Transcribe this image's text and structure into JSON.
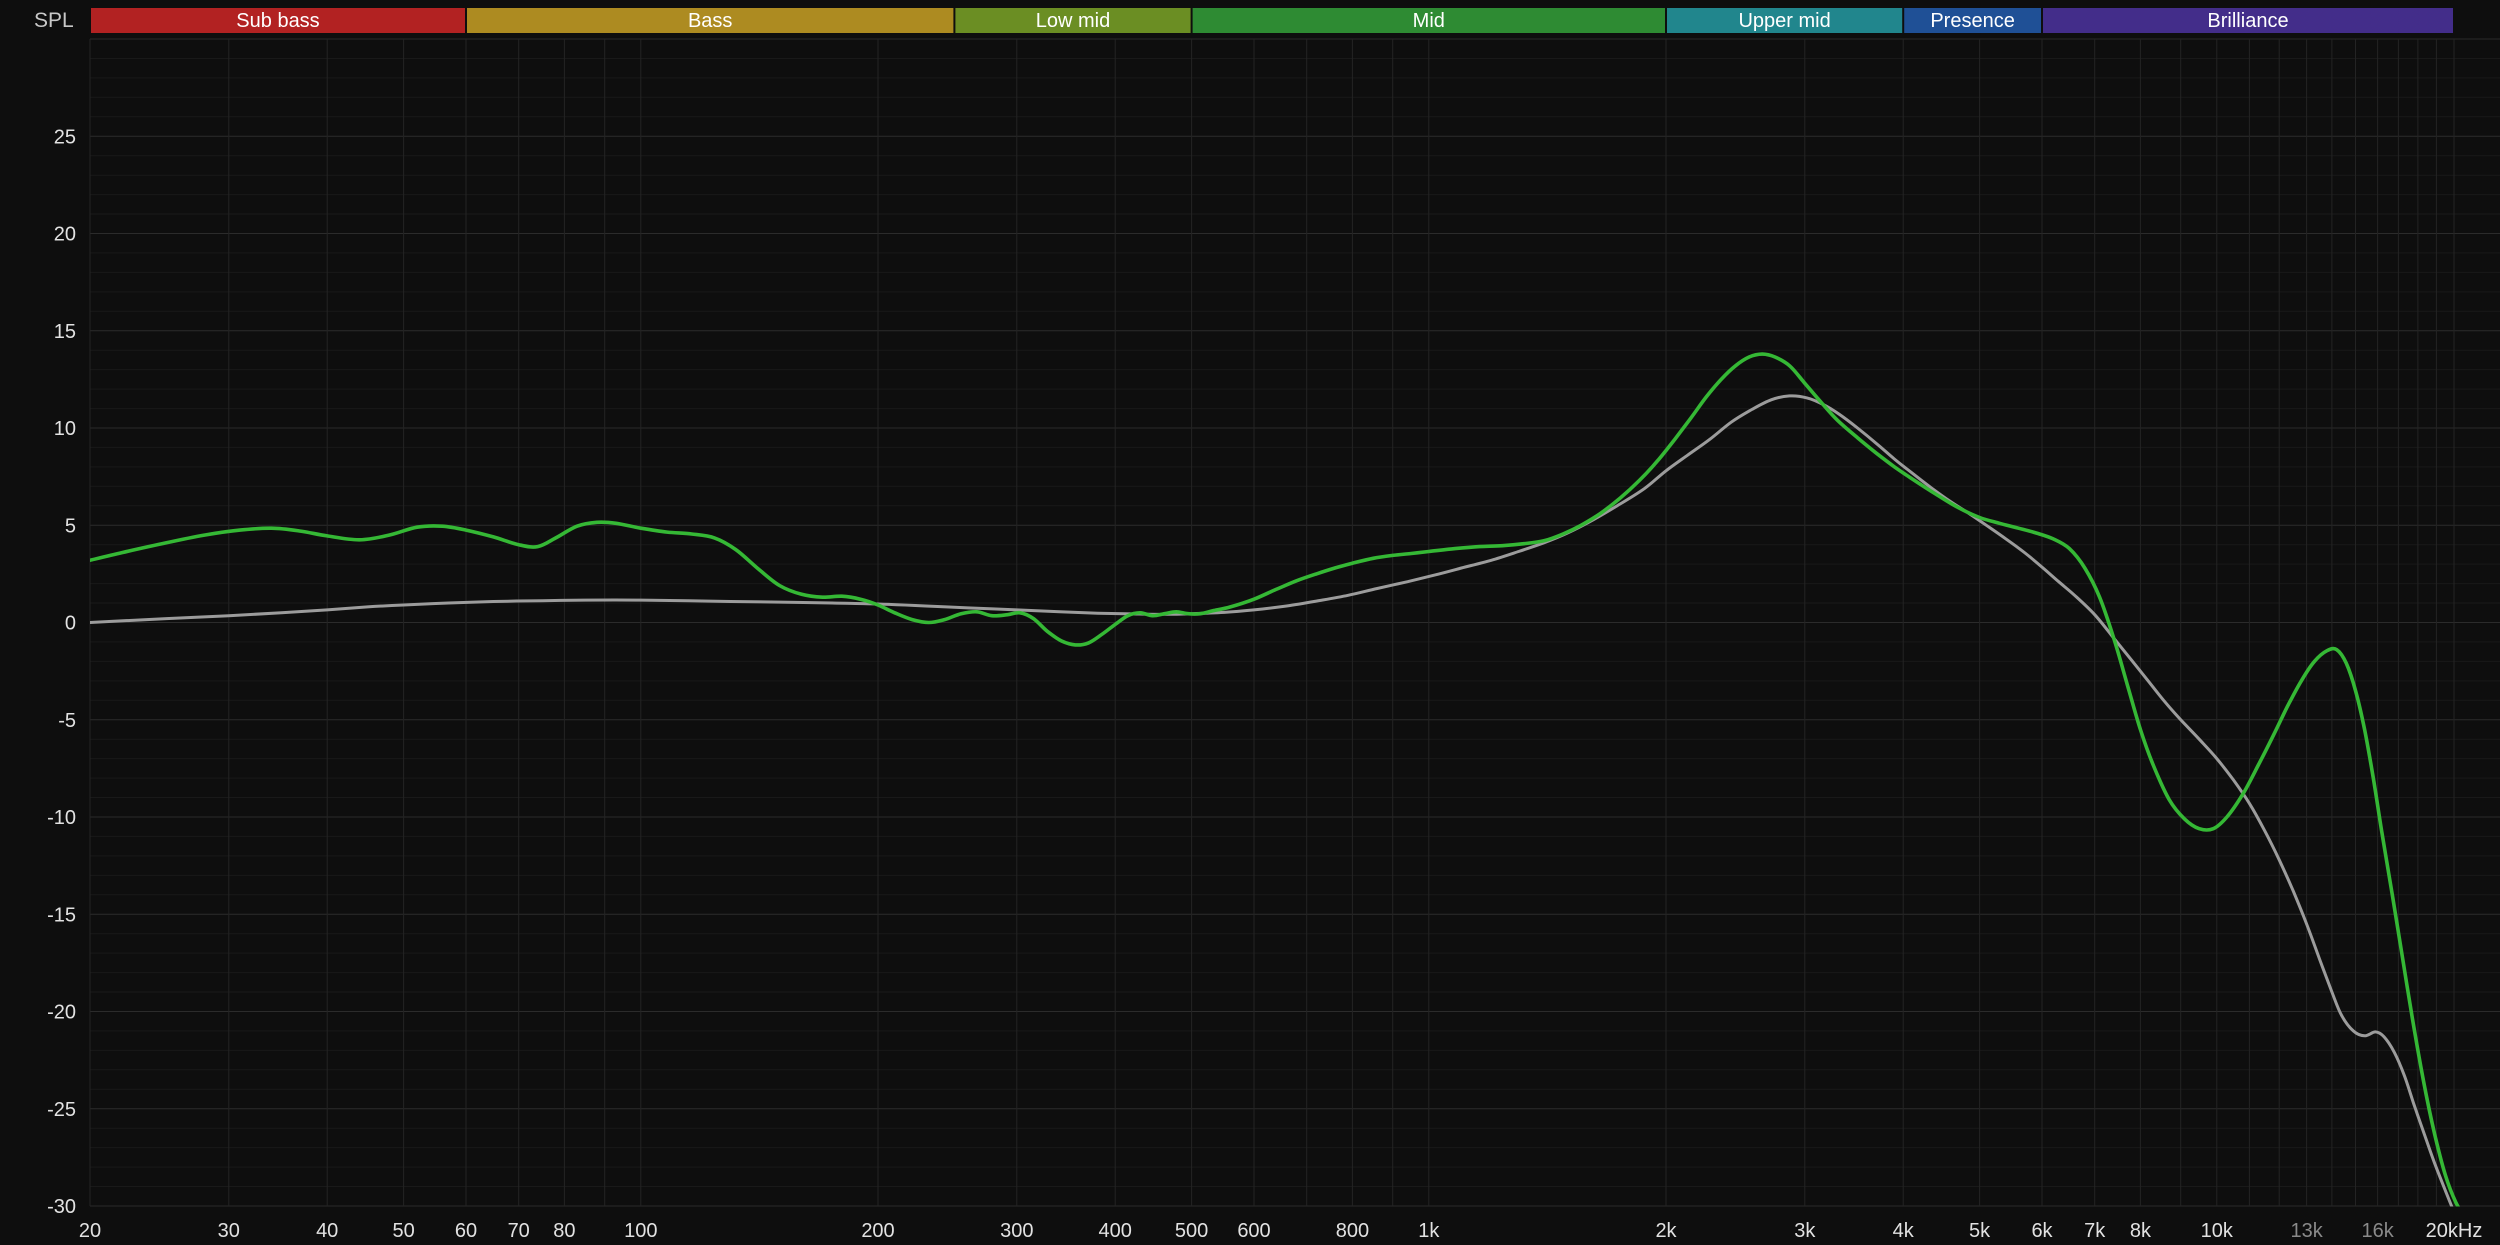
{
  "spl_label": "SPL",
  "colors": {
    "background": "#0e0e0e",
    "grid_major": "#2b2b2b",
    "grid_minor": "#191919",
    "grid_vertical": "#242424",
    "tick_label": "#e2e2e2",
    "tick_label_dim": "#8a8a8a",
    "band_text": "#ffffff",
    "spl_label": "#c8c8c8"
  },
  "band_bar": [
    {
      "label": "Sub bass",
      "color": "#b22222",
      "f_lo": 20,
      "f_hi": 60
    },
    {
      "label": "Bass",
      "color": "#ad8b21",
      "f_lo": 60,
      "f_hi": 250
    },
    {
      "label": "Low mid",
      "color": "#6b8e23",
      "f_lo": 250,
      "f_hi": 500
    },
    {
      "label": "Mid",
      "color": "#2e8b33",
      "f_lo": 500,
      "f_hi": 2000
    },
    {
      "label": "Upper mid",
      "color": "#21868d",
      "f_lo": 2000,
      "f_hi": 4000
    },
    {
      "label": "Presence",
      "color": "#1f5096",
      "f_lo": 4000,
      "f_hi": 6000
    },
    {
      "label": "Brilliance",
      "color": "#432d8a",
      "f_lo": 6000,
      "f_hi": 20000
    }
  ],
  "chart_data": {
    "type": "line",
    "title": "",
    "ylabel": "SPL",
    "x_scale": "log",
    "xlim": [
      20,
      20000
    ],
    "ylim": [
      -30,
      30
    ],
    "grid": true,
    "legend": "none",
    "y_ticks": [
      25,
      20,
      15,
      10,
      5,
      0,
      -5,
      -10,
      -15,
      -20,
      -25,
      -30
    ],
    "y_major_step": 5,
    "y_minor_step": 1,
    "x_ticks": [
      {
        "f": 20,
        "label": "20"
      },
      {
        "f": 30,
        "label": "30"
      },
      {
        "f": 40,
        "label": "40"
      },
      {
        "f": 50,
        "label": "50"
      },
      {
        "f": 60,
        "label": "60"
      },
      {
        "f": 70,
        "label": "70"
      },
      {
        "f": 80,
        "label": "80"
      },
      {
        "f": 100,
        "label": "100"
      },
      {
        "f": 200,
        "label": "200"
      },
      {
        "f": 300,
        "label": "300"
      },
      {
        "f": 400,
        "label": "400"
      },
      {
        "f": 500,
        "label": "500"
      },
      {
        "f": 600,
        "label": "600"
      },
      {
        "f": 800,
        "label": "800"
      },
      {
        "f": 1000,
        "label": "1k"
      },
      {
        "f": 2000,
        "label": "2k"
      },
      {
        "f": 3000,
        "label": "3k"
      },
      {
        "f": 4000,
        "label": "4k"
      },
      {
        "f": 5000,
        "label": "5k"
      },
      {
        "f": 6000,
        "label": "6k"
      },
      {
        "f": 7000,
        "label": "7k"
      },
      {
        "f": 8000,
        "label": "8k"
      },
      {
        "f": 10000,
        "label": "10k"
      },
      {
        "f": 13000,
        "label": "13k",
        "dim": true
      },
      {
        "f": 16000,
        "label": "16k",
        "dim": true
      },
      {
        "f": 20000,
        "label": "20kHz"
      }
    ],
    "v_grid_freqs": [
      20,
      30,
      40,
      50,
      60,
      70,
      80,
      90,
      100,
      200,
      300,
      400,
      500,
      600,
      700,
      800,
      900,
      1000,
      2000,
      3000,
      4000,
      5000,
      6000,
      7000,
      8000,
      9000,
      10000,
      11000,
      12000,
      13000,
      14000,
      15000,
      16000,
      17000,
      18000,
      19000,
      20000
    ],
    "series": [
      {
        "name": "green-curve",
        "color": "#35b835",
        "width": 3.6,
        "points": [
          [
            20,
            3.2
          ],
          [
            22,
            3.6
          ],
          [
            25,
            4.1
          ],
          [
            28,
            4.5
          ],
          [
            31,
            4.75
          ],
          [
            34,
            4.85
          ],
          [
            37,
            4.7
          ],
          [
            40,
            4.45
          ],
          [
            44,
            4.25
          ],
          [
            48,
            4.5
          ],
          [
            52,
            4.9
          ],
          [
            56,
            4.95
          ],
          [
            60,
            4.75
          ],
          [
            65,
            4.4
          ],
          [
            70,
            4.0
          ],
          [
            74,
            3.9
          ],
          [
            78,
            4.35
          ],
          [
            83,
            4.95
          ],
          [
            88,
            5.15
          ],
          [
            93,
            5.1
          ],
          [
            100,
            4.85
          ],
          [
            108,
            4.65
          ],
          [
            116,
            4.55
          ],
          [
            124,
            4.35
          ],
          [
            132,
            3.75
          ],
          [
            141,
            2.75
          ],
          [
            150,
            1.9
          ],
          [
            160,
            1.45
          ],
          [
            170,
            1.3
          ],
          [
            180,
            1.35
          ],
          [
            190,
            1.2
          ],
          [
            200,
            0.9
          ],
          [
            210,
            0.5
          ],
          [
            221,
            0.15
          ],
          [
            232,
            0.0
          ],
          [
            243,
            0.15
          ],
          [
            255,
            0.45
          ],
          [
            267,
            0.55
          ],
          [
            279,
            0.35
          ],
          [
            292,
            0.4
          ],
          [
            303,
            0.5
          ],
          [
            315,
            0.2
          ],
          [
            328,
            -0.45
          ],
          [
            342,
            -0.95
          ],
          [
            356,
            -1.15
          ],
          [
            370,
            -1.05
          ],
          [
            385,
            -0.6
          ],
          [
            400,
            -0.1
          ],
          [
            415,
            0.35
          ],
          [
            430,
            0.5
          ],
          [
            446,
            0.35
          ],
          [
            462,
            0.45
          ],
          [
            478,
            0.55
          ],
          [
            495,
            0.45
          ],
          [
            513,
            0.45
          ],
          [
            532,
            0.6
          ],
          [
            560,
            0.8
          ],
          [
            600,
            1.2
          ],
          [
            640,
            1.7
          ],
          [
            680,
            2.15
          ],
          [
            720,
            2.5
          ],
          [
            760,
            2.8
          ],
          [
            800,
            3.05
          ],
          [
            850,
            3.3
          ],
          [
            900,
            3.45
          ],
          [
            950,
            3.55
          ],
          [
            1000,
            3.65
          ],
          [
            1080,
            3.8
          ],
          [
            1160,
            3.9
          ],
          [
            1240,
            3.95
          ],
          [
            1320,
            4.05
          ],
          [
            1400,
            4.2
          ],
          [
            1480,
            4.55
          ],
          [
            1560,
            5.0
          ],
          [
            1650,
            5.6
          ],
          [
            1750,
            6.4
          ],
          [
            1850,
            7.3
          ],
          [
            1950,
            8.3
          ],
          [
            2050,
            9.4
          ],
          [
            2150,
            10.5
          ],
          [
            2250,
            11.6
          ],
          [
            2350,
            12.5
          ],
          [
            2450,
            13.2
          ],
          [
            2550,
            13.65
          ],
          [
            2650,
            13.8
          ],
          [
            2750,
            13.65
          ],
          [
            2870,
            13.2
          ],
          [
            3000,
            12.3
          ],
          [
            3150,
            11.3
          ],
          [
            3300,
            10.4
          ],
          [
            3500,
            9.5
          ],
          [
            3700,
            8.7
          ],
          [
            3900,
            8.0
          ],
          [
            4100,
            7.4
          ],
          [
            4400,
            6.6
          ],
          [
            4700,
            5.9
          ],
          [
            5000,
            5.4
          ],
          [
            5300,
            5.1
          ],
          [
            5600,
            4.85
          ],
          [
            5900,
            4.6
          ],
          [
            6200,
            4.3
          ],
          [
            6500,
            3.8
          ],
          [
            6800,
            2.8
          ],
          [
            7100,
            1.3
          ],
          [
            7400,
            -0.8
          ],
          [
            7700,
            -3.2
          ],
          [
            8000,
            -5.5
          ],
          [
            8300,
            -7.3
          ],
          [
            8700,
            -9.1
          ],
          [
            9100,
            -10.1
          ],
          [
            9500,
            -10.6
          ],
          [
            9900,
            -10.6
          ],
          [
            10300,
            -10.0
          ],
          [
            10800,
            -8.8
          ],
          [
            11300,
            -7.3
          ],
          [
            11800,
            -5.8
          ],
          [
            12300,
            -4.3
          ],
          [
            12800,
            -3.0
          ],
          [
            13300,
            -2.0
          ],
          [
            13800,
            -1.45
          ],
          [
            14200,
            -1.4
          ],
          [
            14600,
            -2.1
          ],
          [
            15000,
            -3.5
          ],
          [
            15400,
            -5.5
          ],
          [
            15800,
            -8.0
          ],
          [
            16200,
            -10.8
          ],
          [
            16700,
            -14.0
          ],
          [
            17200,
            -17.2
          ],
          [
            17700,
            -20.3
          ],
          [
            18300,
            -23.6
          ],
          [
            18900,
            -26.3
          ],
          [
            19500,
            -28.4
          ],
          [
            20100,
            -29.8
          ],
          [
            20800,
            -30.8
          ],
          [
            21400,
            -31.5
          ]
        ]
      },
      {
        "name": "gray-curve",
        "color": "#9c9c9c",
        "width": 3.0,
        "points": [
          [
            20,
            0.0
          ],
          [
            25,
            0.2
          ],
          [
            30,
            0.35
          ],
          [
            35,
            0.5
          ],
          [
            40,
            0.65
          ],
          [
            45,
            0.8
          ],
          [
            50,
            0.9
          ],
          [
            57,
            1.0
          ],
          [
            65,
            1.08
          ],
          [
            75,
            1.12
          ],
          [
            85,
            1.15
          ],
          [
            100,
            1.15
          ],
          [
            115,
            1.12
          ],
          [
            130,
            1.08
          ],
          [
            150,
            1.05
          ],
          [
            175,
            1.0
          ],
          [
            200,
            0.95
          ],
          [
            230,
            0.85
          ],
          [
            260,
            0.75
          ],
          [
            300,
            0.65
          ],
          [
            340,
            0.55
          ],
          [
            380,
            0.48
          ],
          [
            420,
            0.44
          ],
          [
            460,
            0.42
          ],
          [
            500,
            0.45
          ],
          [
            550,
            0.52
          ],
          [
            600,
            0.65
          ],
          [
            660,
            0.85
          ],
          [
            720,
            1.1
          ],
          [
            790,
            1.4
          ],
          [
            860,
            1.75
          ],
          [
            940,
            2.1
          ],
          [
            1020,
            2.45
          ],
          [
            1100,
            2.8
          ],
          [
            1200,
            3.2
          ],
          [
            1300,
            3.65
          ],
          [
            1400,
            4.1
          ],
          [
            1500,
            4.6
          ],
          [
            1620,
            5.3
          ],
          [
            1750,
            6.1
          ],
          [
            1880,
            6.9
          ],
          [
            2000,
            7.8
          ],
          [
            2130,
            8.6
          ],
          [
            2270,
            9.4
          ],
          [
            2420,
            10.3
          ],
          [
            2570,
            10.95
          ],
          [
            2720,
            11.45
          ],
          [
            2870,
            11.65
          ],
          [
            3020,
            11.55
          ],
          [
            3170,
            11.2
          ],
          [
            3320,
            10.7
          ],
          [
            3500,
            10.0
          ],
          [
            3700,
            9.2
          ],
          [
            3900,
            8.4
          ],
          [
            4100,
            7.7
          ],
          [
            4350,
            6.9
          ],
          [
            4600,
            6.2
          ],
          [
            4850,
            5.6
          ],
          [
            5100,
            5.0
          ],
          [
            5400,
            4.3
          ],
          [
            5700,
            3.6
          ],
          [
            6000,
            2.85
          ],
          [
            6300,
            2.1
          ],
          [
            6600,
            1.4
          ],
          [
            7000,
            0.4
          ],
          [
            7400,
            -0.8
          ],
          [
            7800,
            -1.95
          ],
          [
            8200,
            -3.05
          ],
          [
            8600,
            -4.1
          ],
          [
            9000,
            -5.0
          ],
          [
            9500,
            -6.0
          ],
          [
            10000,
            -7.0
          ],
          [
            10500,
            -8.1
          ],
          [
            11000,
            -9.3
          ],
          [
            11500,
            -10.7
          ],
          [
            12000,
            -12.2
          ],
          [
            12500,
            -13.8
          ],
          [
            13000,
            -15.5
          ],
          [
            13500,
            -17.3
          ],
          [
            14000,
            -19.0
          ],
          [
            14400,
            -20.2
          ],
          [
            14900,
            -21.0
          ],
          [
            15400,
            -21.25
          ],
          [
            15900,
            -21.05
          ],
          [
            16300,
            -21.3
          ],
          [
            16800,
            -22.1
          ],
          [
            17300,
            -23.3
          ],
          [
            17800,
            -24.8
          ],
          [
            18300,
            -26.2
          ],
          [
            18900,
            -27.8
          ],
          [
            19500,
            -29.2
          ],
          [
            20100,
            -30.5
          ],
          [
            20700,
            -31.5
          ]
        ]
      }
    ]
  }
}
